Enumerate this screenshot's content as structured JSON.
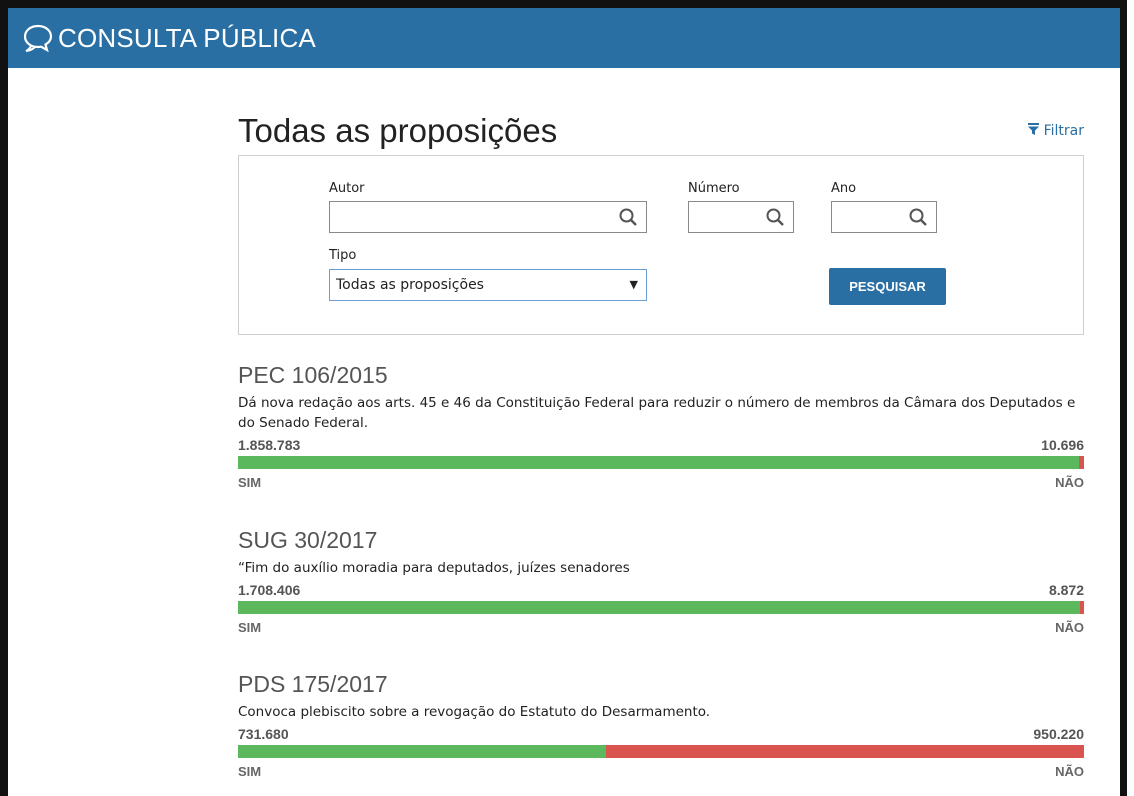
{
  "header": {
    "brand": "CONSULTA PÚBLICA",
    "brand_icon": "speech-bubble-icon",
    "color": "#2a6fa3"
  },
  "page": {
    "title": "Todas as proposições",
    "filter_label": "Filtrar",
    "filter_icon": "funnel-icon"
  },
  "form": {
    "autor_label": "Autor",
    "numero_label": "Número",
    "ano_label": "Ano",
    "tipo_label": "Tipo",
    "tipo_value": "Todas as proposições",
    "search_button": "PESQUISAR"
  },
  "colors": {
    "yes": "#5cb85c",
    "no": "#d9534f"
  },
  "proposicoes": [
    {
      "title": "PEC 106/2015",
      "description": "Dá nova redação aos arts. 45 e 46 da Constituição Federal para reduzir o número de membros da Câmara dos Deputados e do Senado Federal.",
      "yes_votes": "1.858.783",
      "no_votes": "10.696",
      "yes_fraction": 0.9943,
      "yes_label": "SIM",
      "no_label": "NÃO"
    },
    {
      "title": "SUG 30/2017",
      "description": "“Fim do auxílio moradia para deputados, juízes senadores",
      "yes_votes": "1.708.406",
      "no_votes": "8.872",
      "yes_fraction": 0.9948,
      "yes_label": "SIM",
      "no_label": "NÃO"
    },
    {
      "title": "PDS 175/2017",
      "description": "Convoca plebiscito sobre a revogação do Estatuto do Desarmamento.",
      "yes_votes": "731.680",
      "no_votes": "950.220",
      "yes_fraction": 0.435,
      "yes_label": "SIM",
      "no_label": "NÃO"
    }
  ]
}
